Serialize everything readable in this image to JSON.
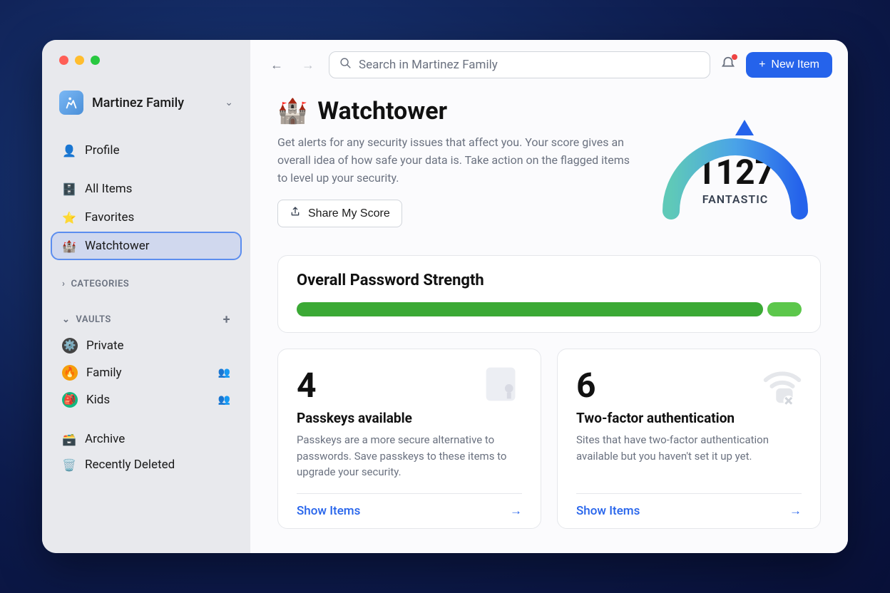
{
  "account": {
    "name": "Martinez Family"
  },
  "sidebar": {
    "profile": "Profile",
    "all_items": "All Items",
    "favorites": "Favorites",
    "watchtower": "Watchtower",
    "categories_hdr": "CATEGORIES",
    "vaults_hdr": "VAULTS",
    "vaults": [
      {
        "name": "Private"
      },
      {
        "name": "Family"
      },
      {
        "name": "Kids"
      }
    ],
    "archive": "Archive",
    "deleted": "Recently Deleted"
  },
  "topbar": {
    "search_placeholder": "Search in Martinez Family",
    "new_item": "New Item"
  },
  "hero": {
    "title": "Watchtower",
    "desc": "Get alerts for any security issues that affect you. Your score gives an overall idea of how safe your data is. Take action on the flagged items to level up your security.",
    "share": "Share My Score",
    "score": "1127",
    "score_label": "FANTASTIC"
  },
  "strength": {
    "title": "Overall Password Strength"
  },
  "cards": {
    "passkeys": {
      "count": "4",
      "title": "Passkeys available",
      "desc": "Passkeys are a more secure alternative to passwords. Save passkeys to these items to upgrade your security.",
      "action": "Show Items"
    },
    "twofa": {
      "count": "6",
      "title": "Two-factor authentication",
      "desc": "Sites that have two-factor authentication available but you haven't set it up yet.",
      "action": "Show Items"
    }
  }
}
